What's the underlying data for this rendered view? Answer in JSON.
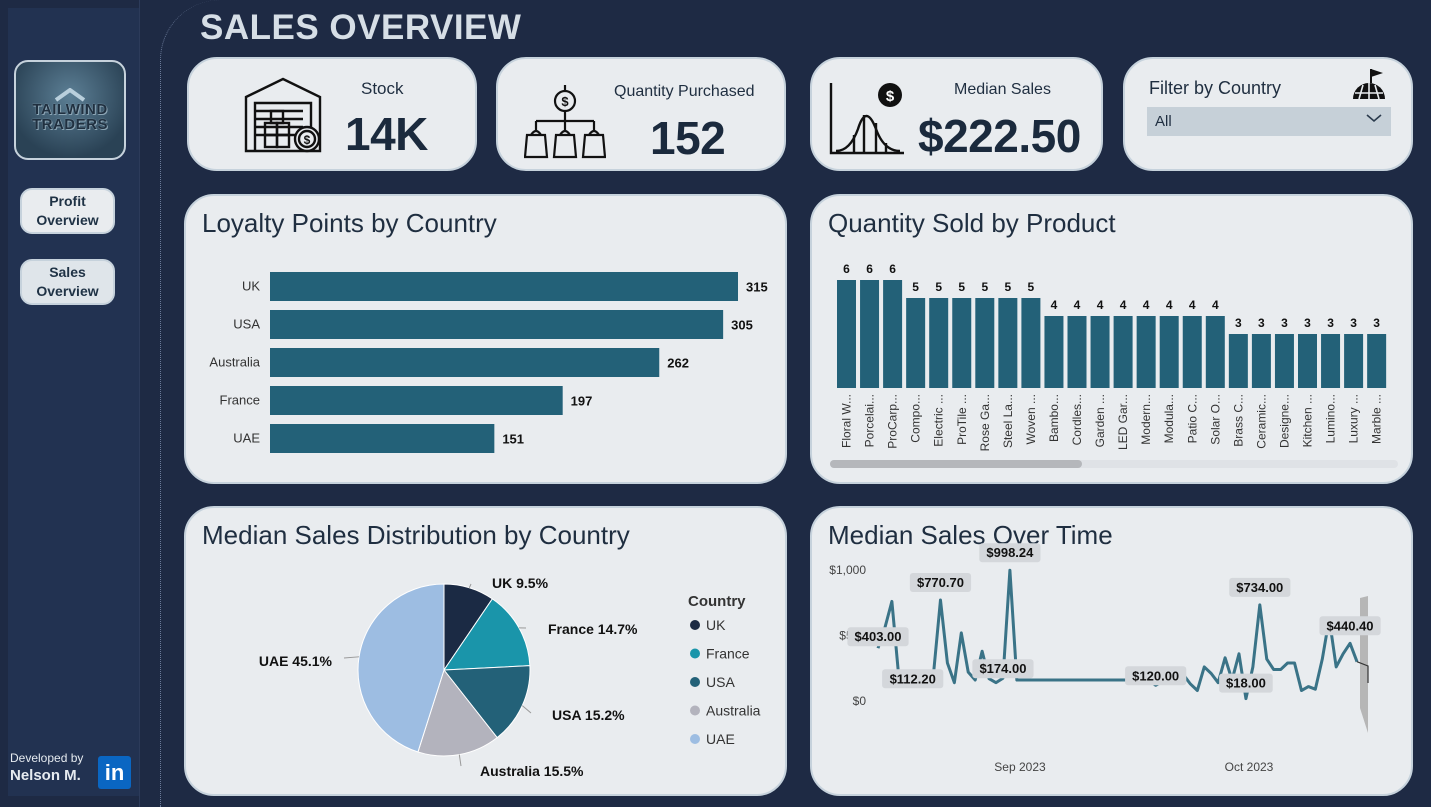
{
  "title": "SALES OVERVIEW",
  "sidebar": {
    "logo_line1": "TAILWIND",
    "logo_line2": "TRADERS",
    "nav": [
      {
        "label_1": "Profit",
        "label_2": "Overview"
      },
      {
        "label_1": "Sales",
        "label_2": "Overview"
      }
    ],
    "developed_by": "Developed by",
    "developer": "Nelson M.",
    "linkedin": "in"
  },
  "kpis": {
    "stock": {
      "label": "Stock",
      "value": "14K",
      "icon": "warehouse-icon"
    },
    "quantity": {
      "label": "Quantity Purchased",
      "value": "152",
      "icon": "shopping-bags-icon"
    },
    "median": {
      "label": "Median Sales",
      "value": "$222.50",
      "icon": "bell-curve-dollar-icon"
    }
  },
  "filter": {
    "label": "Filter by Country",
    "value": "All",
    "icon": "globe-flag-icon"
  },
  "colors": {
    "bar": "#236178",
    "uk": "#1b2a44",
    "france": "#1a95aa",
    "usa": "#236178",
    "australia": "#b3b3bd",
    "uae": "#9dbde2",
    "line": "#3a7387"
  },
  "loyalty": {
    "title": "Loyalty Points by Country",
    "chart_data": {
      "type": "bar",
      "orientation": "horizontal",
      "categories": [
        "UK",
        "USA",
        "Australia",
        "France",
        "UAE"
      ],
      "values": [
        315,
        305,
        262,
        197,
        151
      ]
    }
  },
  "products": {
    "title": "Quantity Sold by Product",
    "chart_data": {
      "type": "bar",
      "categories": [
        "Floral W...",
        "Porcelai...",
        "ProCarp...",
        "Compo...",
        "Electric ...",
        "ProTile ...",
        "Rose Ga...",
        "Steel La...",
        "Woven ...",
        "Bambo...",
        "Cordles...",
        "Garden ...",
        "LED Gar...",
        "Modern...",
        "Modula...",
        "Patio C...",
        "Solar O...",
        "Brass C...",
        "Ceramic...",
        "Designe...",
        "Kitchen ...",
        "Lumino...",
        "Luxury ...",
        "Marble ..."
      ],
      "values": [
        6,
        6,
        6,
        5,
        5,
        5,
        5,
        5,
        5,
        4,
        4,
        4,
        4,
        4,
        4,
        4,
        4,
        3,
        3,
        3,
        3,
        3,
        3,
        3
      ]
    }
  },
  "pie": {
    "title": "Median Sales Distribution by Country",
    "legend_title": "Country",
    "chart_data": {
      "type": "pie",
      "labels": [
        "UK",
        "France",
        "USA",
        "Australia",
        "UAE"
      ],
      "values": [
        9.5,
        14.7,
        15.2,
        15.5,
        45.1
      ],
      "data_labels": [
        "UK 9.5%",
        "France 14.7%",
        "USA 15.2%",
        "Australia 15.5%",
        "UAE 45.1%"
      ]
    }
  },
  "timeline": {
    "title": "Median Sales Over Time",
    "chart_data": {
      "type": "line",
      "y_ticks": [
        "$1,000",
        "$500",
        "$0"
      ],
      "ylim": [
        0,
        1000
      ],
      "x_ticks": [
        "Sep 2023",
        "Oct 2023"
      ],
      "values": [
        403,
        560,
        760,
        180,
        140,
        112.2,
        120,
        140,
        210,
        770.7,
        290,
        140,
        520,
        220,
        160,
        380,
        170,
        140,
        174,
        998.24,
        160,
        160,
        160,
        160,
        160,
        160,
        160,
        160,
        160,
        160,
        160,
        160,
        160,
        160,
        160,
        160,
        160,
        160,
        160,
        160,
        120,
        150,
        160,
        170,
        200,
        130,
        80,
        260,
        210,
        140,
        330,
        160,
        360,
        18,
        260,
        734,
        320,
        240,
        240,
        290,
        290,
        80,
        110,
        90,
        320,
        630,
        260,
        360,
        440.4,
        300
      ],
      "data_labels": [
        {
          "index": 0,
          "text": "$403.00"
        },
        {
          "index": 5,
          "text": "$112.20"
        },
        {
          "index": 9,
          "text": "$770.70"
        },
        {
          "index": 18,
          "text": "$174.00"
        },
        {
          "index": 19,
          "text": "$998.24"
        },
        {
          "index": 40,
          "text": "$120.00"
        },
        {
          "index": 53,
          "text": "$18.00"
        },
        {
          "index": 55,
          "text": "$734.00"
        },
        {
          "index": 68,
          "text": "$440.40"
        }
      ]
    }
  }
}
